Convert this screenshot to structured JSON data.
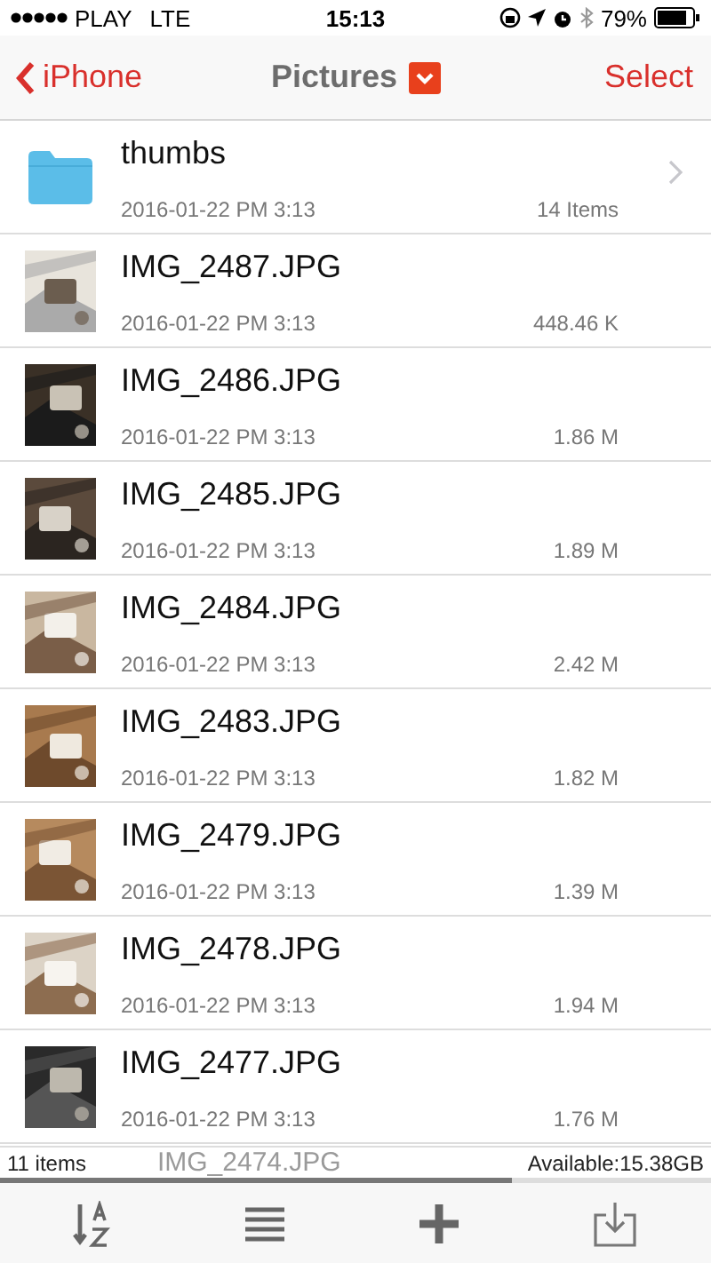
{
  "status_bar": {
    "carrier": "PLAY",
    "network": "LTE",
    "time": "15:13",
    "battery": "79%"
  },
  "nav": {
    "back": "iPhone",
    "title": "Pictures",
    "action": "Select"
  },
  "items": [
    {
      "kind": "folder",
      "name": "thumbs",
      "date": "2016-01-22 PM 3:13",
      "info": "14 Items"
    },
    {
      "kind": "file",
      "name": "IMG_2487.JPG",
      "date": "2016-01-22 PM 3:13",
      "info": "448.46 K"
    },
    {
      "kind": "file",
      "name": "IMG_2486.JPG",
      "date": "2016-01-22 PM 3:13",
      "info": "1.86 M"
    },
    {
      "kind": "file",
      "name": "IMG_2485.JPG",
      "date": "2016-01-22 PM 3:13",
      "info": "1.89 M"
    },
    {
      "kind": "file",
      "name": "IMG_2484.JPG",
      "date": "2016-01-22 PM 3:13",
      "info": "2.42 M"
    },
    {
      "kind": "file",
      "name": "IMG_2483.JPG",
      "date": "2016-01-22 PM 3:13",
      "info": "1.82 M"
    },
    {
      "kind": "file",
      "name": "IMG_2479.JPG",
      "date": "2016-01-22 PM 3:13",
      "info": "1.39 M"
    },
    {
      "kind": "file",
      "name": "IMG_2478.JPG",
      "date": "2016-01-22 PM 3:13",
      "info": "1.94 M"
    },
    {
      "kind": "file",
      "name": "IMG_2477.JPG",
      "date": "2016-01-22 PM 3:13",
      "info": "1.76 M"
    }
  ],
  "footer": {
    "count": "11 items",
    "hidden_row": "IMG_2474.JPG",
    "available": "Available:15.38GB",
    "level": 0.72
  }
}
